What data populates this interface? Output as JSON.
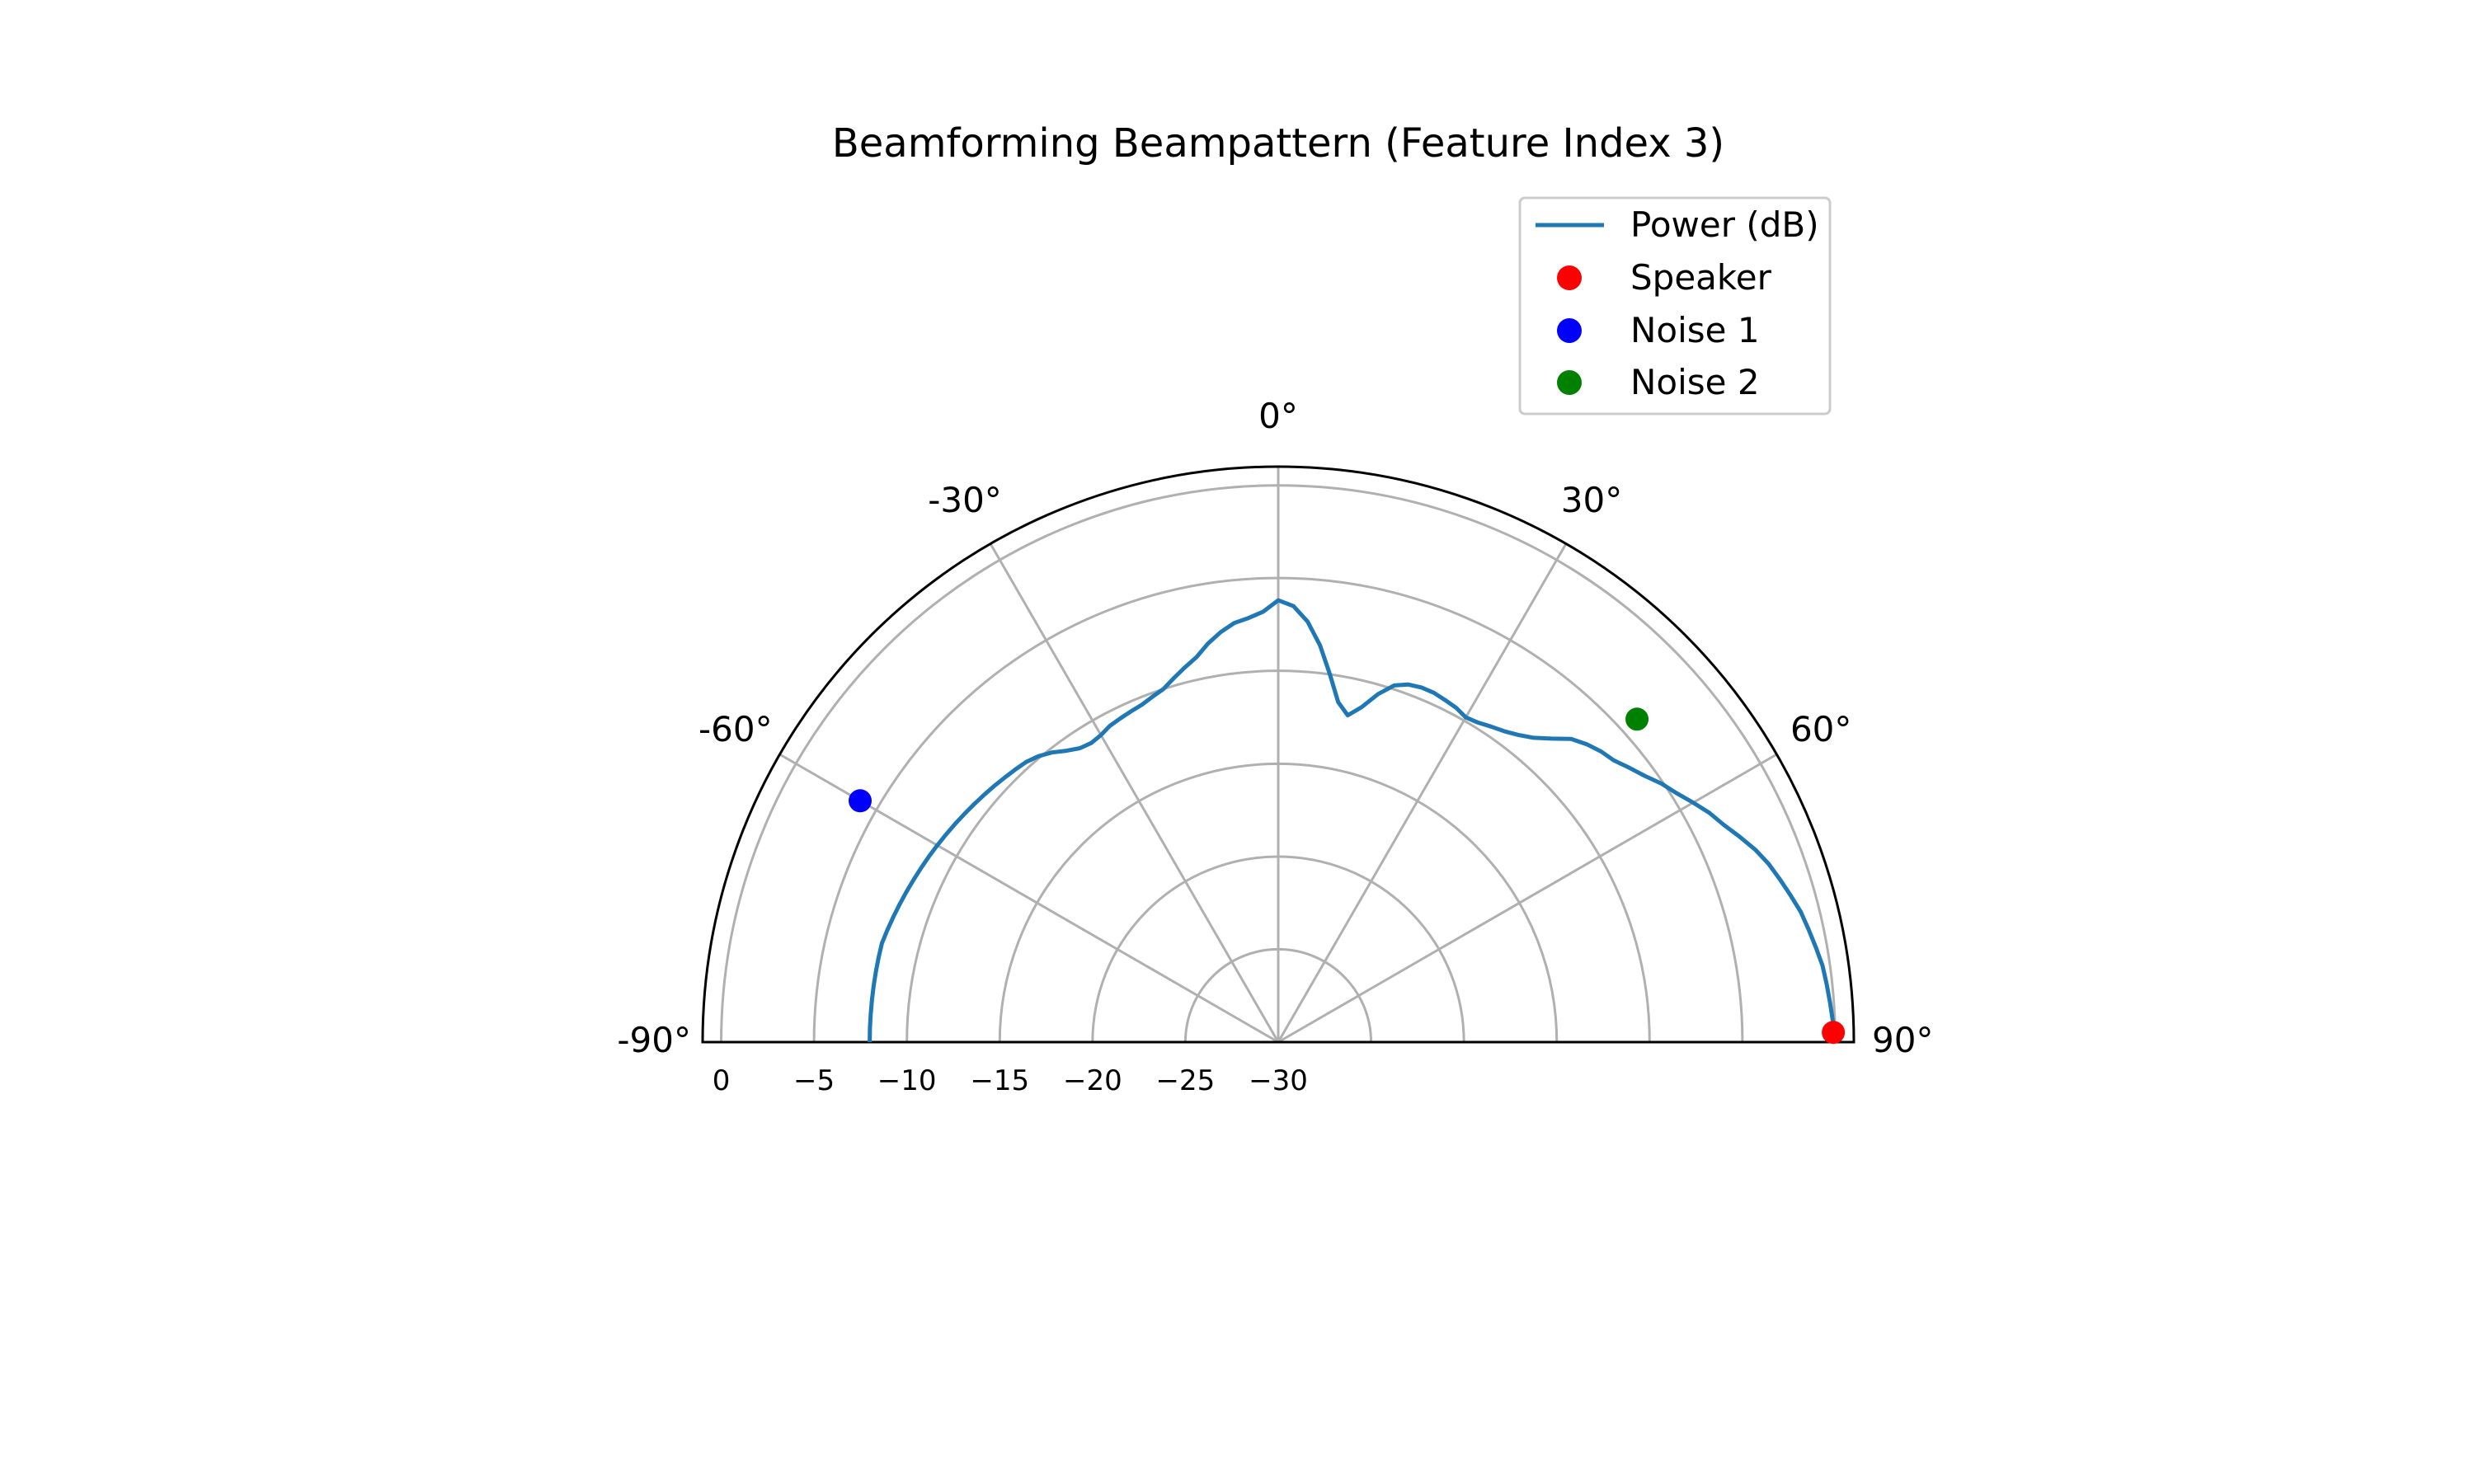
{
  "chart_data": {
    "type": "polar-line",
    "title": "Beamforming Beampattern (Feature Index 3)",
    "theta_range_deg": [
      -90,
      90
    ],
    "theta_zero_location": "top",
    "theta_direction": "clockwise",
    "r_range": [
      -30,
      1
    ],
    "r_direction": "inverted",
    "grid": true,
    "legend_position": "top-right",
    "angle_tick_labels": [
      {
        "deg": -90,
        "label": "-90°"
      },
      {
        "deg": -60,
        "label": "-60°"
      },
      {
        "deg": -30,
        "label": "-30°"
      },
      {
        "deg": 0,
        "label": "0°"
      },
      {
        "deg": 30,
        "label": "30°"
      },
      {
        "deg": 60,
        "label": "60°"
      },
      {
        "deg": 90,
        "label": "90°"
      }
    ],
    "radial_tick_labels": [
      {
        "value": 0,
        "label": "0"
      },
      {
        "value": -5,
        "label": "−5"
      },
      {
        "value": -10,
        "label": "−10"
      },
      {
        "value": -15,
        "label": "−15"
      },
      {
        "value": -20,
        "label": "−20"
      },
      {
        "value": -25,
        "label": "−25"
      },
      {
        "value": -30,
        "label": "−30"
      }
    ],
    "series": [
      {
        "name": "Power (dB)",
        "type": "line",
        "color": "#1f77b4",
        "theta_deg": [
          -90,
          -88,
          -86,
          -84,
          -82,
          -80,
          -78,
          -76,
          -74,
          -72,
          -70,
          -68,
          -66,
          -64,
          -62,
          -60,
          -58,
          -56,
          -54,
          -52,
          -50,
          -48,
          -46,
          -44,
          -42,
          -40,
          -38,
          -36,
          -34,
          -32,
          -30,
          -28,
          -26,
          -24,
          -22,
          -20,
          -18,
          -16,
          -14,
          -12,
          -10,
          -8,
          -6,
          -4,
          -2,
          0,
          2,
          4,
          6,
          8,
          10,
          12,
          14,
          16,
          18,
          20,
          22,
          24,
          26,
          28,
          30,
          32,
          34,
          36,
          38,
          40,
          42,
          44,
          46,
          48,
          50,
          52,
          54,
          56,
          58,
          60,
          62,
          64,
          66,
          68,
          70,
          72,
          74,
          76,
          78,
          80,
          82,
          84,
          86,
          88,
          90
        ],
        "r": [
          -8.0,
          -8.0,
          -8.0,
          -8.0,
          -8.0,
          -8.0,
          -8.0,
          -8.0,
          -8.1,
          -8.2,
          -8.3,
          -8.4,
          -8.5,
          -8.6,
          -8.7,
          -8.8,
          -8.9,
          -9.0,
          -9.1,
          -9.2,
          -9.3,
          -9.4,
          -9.5,
          -9.6,
          -9.7,
          -9.9,
          -10.2,
          -10.6,
          -10.9,
          -11.0,
          -10.9,
          -10.7,
          -10.6,
          -10.5,
          -10.4,
          -10.2,
          -10.0,
          -9.6,
          -9.2,
          -8.8,
          -8.2,
          -7.7,
          -7.3,
          -7.1,
          -6.8,
          -6.2,
          -6.5,
          -7.3,
          -8.5,
          -10.0,
          -11.4,
          -12.0,
          -11.4,
          -10.5,
          -9.8,
          -9.5,
          -9.4,
          -9.4,
          -9.5,
          -9.6,
          -9.8,
          -9.7,
          -9.5,
          -9.3,
          -9.0,
          -8.6,
          -8.0,
          -7.3,
          -6.9,
          -6.6,
          -6.4,
          -6.0,
          -5.6,
          -5.1,
          -4.7,
          -4.2,
          -3.7,
          -3.3,
          -2.8,
          -2.3,
          -1.9,
          -1.6,
          -1.3,
          -1.0,
          -0.8,
          -0.6,
          -0.4,
          -0.3,
          -0.2,
          -0.1,
          0.0
        ]
      },
      {
        "name": "Speaker",
        "type": "point",
        "color": "#ff0000",
        "theta_deg": [
          89
        ],
        "r": [
          -0.1
        ]
      },
      {
        "name": "Noise 1",
        "type": "point",
        "color": "#0000ff",
        "theta_deg": [
          -60
        ],
        "r": [
          -4
        ]
      },
      {
        "name": "Noise 2",
        "type": "point",
        "color": "#008000",
        "theta_deg": [
          48
        ],
        "r": [
          -4
        ]
      }
    ]
  }
}
